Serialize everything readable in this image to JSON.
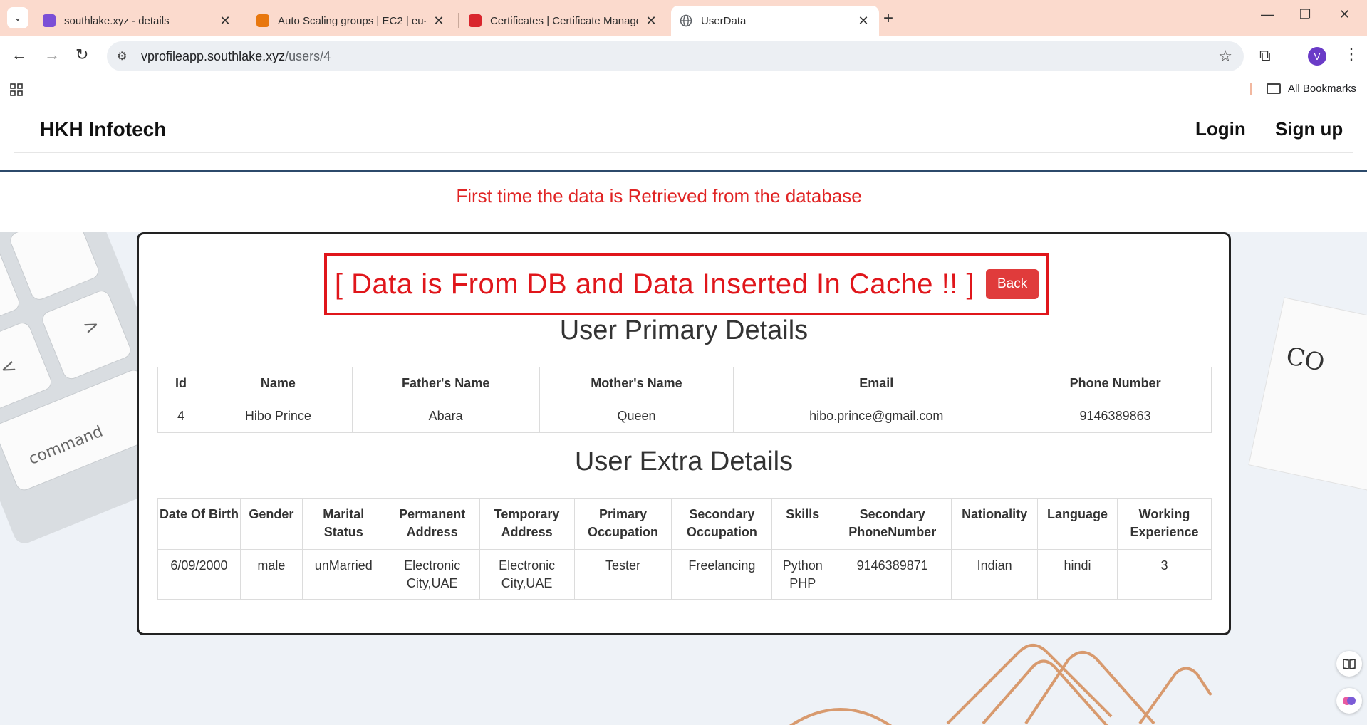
{
  "browser": {
    "tabs": [
      {
        "title": "southlake.xyz - details",
        "favicon_color": "#7b4fd6",
        "active": false
      },
      {
        "title": "Auto Scaling groups | EC2 | eu-",
        "favicon_color": "#e8770e",
        "active": false
      },
      {
        "title": "Certificates | Certificate Manage",
        "favicon_color": "#d9262d",
        "active": false
      },
      {
        "title": "UserData",
        "favicon_color": "#5f6368",
        "active": true
      }
    ],
    "url_host": "vprofileapp.southlake.xyz",
    "url_path": "/users/4",
    "profile_initial": "V",
    "all_bookmarks_label": "All Bookmarks"
  },
  "site": {
    "brand": "HKH Infotech",
    "nav_login": "Login",
    "nav_signup": "Sign up"
  },
  "notice": "First time the data is Retrieved from the database",
  "banner": {
    "text": "[ Data is From DB and Data Inserted In Cache !! ]",
    "back_label": "Back",
    "accent_color": "#e0161b"
  },
  "primary": {
    "title": "User Primary Details",
    "headers": [
      "Id",
      "Name",
      "Father's Name",
      "Mother's Name",
      "Email",
      "Phone Number"
    ],
    "row": [
      "4",
      "Hibo Prince",
      "Abara",
      "Queen",
      "hibo.prince@gmail.com",
      "9146389863"
    ]
  },
  "extra": {
    "title": "User Extra Details",
    "headers": [
      "Date Of Birth",
      "Gender",
      "Marital Status",
      "Permanent Address",
      "Temporary Address",
      "Primary Occupation",
      "Secondary Occupation",
      "Skills",
      "Secondary PhoneNumber",
      "Nationality",
      "Language",
      "Working Experience"
    ],
    "row": [
      "6/09/2000",
      "male",
      "unMarried",
      "Electronic City,UAE",
      "Electronic City,UAE",
      "Tester",
      "Freelancing",
      "Python PHP",
      "9146389871",
      "Indian",
      "hindi",
      "3"
    ]
  }
}
